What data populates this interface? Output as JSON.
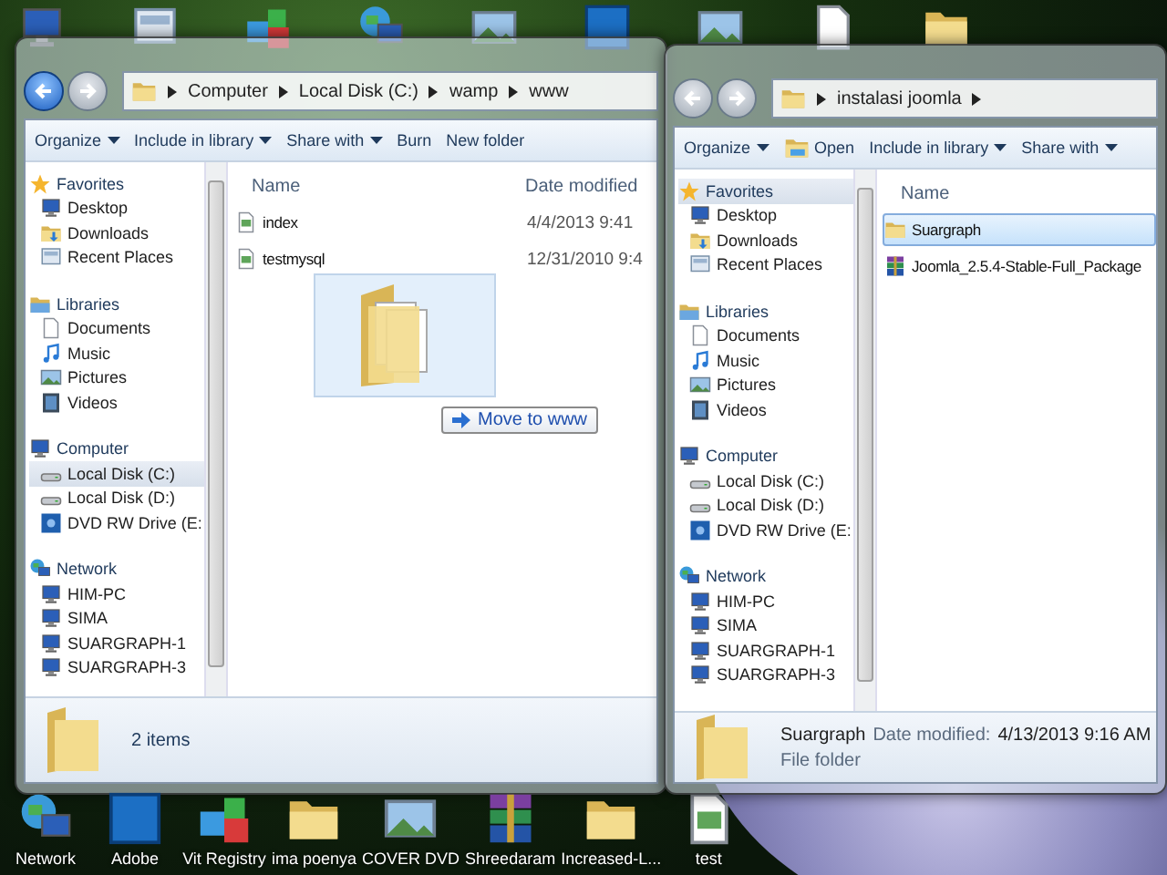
{
  "desktop_icons": [
    {
      "label": "Network",
      "kind": "network"
    },
    {
      "label": "Adobe",
      "kind": "app"
    },
    {
      "label": "Vit Registry",
      "kind": "tools"
    },
    {
      "label": "ima poenya",
      "kind": "folder"
    },
    {
      "label": "COVER DVD",
      "kind": "image"
    },
    {
      "label": "Shreedaram",
      "kind": "archive"
    },
    {
      "label": "Increased-L...",
      "kind": "folder"
    },
    {
      "label": "test",
      "kind": "file"
    }
  ],
  "windows": [
    {
      "back_enabled": true,
      "address": [
        "Computer",
        "Local Disk (C:)",
        "wamp",
        "www"
      ],
      "trailing_arrow": false,
      "toolbar": [
        {
          "label": "Organize",
          "kind": "dropdown"
        },
        {
          "label": "Include in library",
          "kind": "dropdown"
        },
        {
          "label": "Share with",
          "kind": "dropdown"
        },
        {
          "label": "Burn",
          "kind": "button"
        },
        {
          "label": "New folder",
          "kind": "button"
        }
      ],
      "nav": [
        {
          "label": "Favorites",
          "kind": "star",
          "selected": false,
          "children": [
            {
              "label": "Desktop",
              "kind": "monitor",
              "selected": false
            },
            {
              "label": "Downloads",
              "kind": "downloads",
              "selected": false
            },
            {
              "label": "Recent Places",
              "kind": "recent",
              "selected": false
            }
          ]
        },
        {
          "label": "Libraries",
          "kind": "library",
          "selected": false,
          "children": [
            {
              "label": "Documents",
              "kind": "document",
              "selected": false
            },
            {
              "label": "Music",
              "kind": "music",
              "selected": false
            },
            {
              "label": "Pictures",
              "kind": "picture",
              "selected": false
            },
            {
              "label": "Videos",
              "kind": "video",
              "selected": false
            }
          ]
        },
        {
          "label": "Computer",
          "kind": "computer",
          "selected": false,
          "children": [
            {
              "label": "Local Disk (C:)",
              "kind": "disk",
              "selected": true
            },
            {
              "label": "Local Disk (D:)",
              "kind": "disk",
              "selected": false
            },
            {
              "label": "DVD RW Drive (E:",
              "kind": "dvd",
              "selected": false
            }
          ]
        },
        {
          "label": "Network",
          "kind": "network",
          "selected": false,
          "children": [
            {
              "label": "HIM-PC",
              "kind": "computer",
              "selected": false
            },
            {
              "label": "SIMA",
              "kind": "computer",
              "selected": false
            },
            {
              "label": "SUARGRAPH-1",
              "kind": "computer",
              "selected": false
            },
            {
              "label": "SUARGRAPH-3",
              "kind": "computer",
              "selected": false
            }
          ]
        }
      ],
      "columns": [
        "Name",
        "Date modified"
      ],
      "files": [
        {
          "name": "index",
          "kind": "file",
          "date": "4/4/2013 9:41",
          "selected": false
        },
        {
          "name": "testmysql",
          "kind": "file",
          "date": "12/31/2010 9:4",
          "selected": false
        }
      ],
      "status": {
        "text": "2 items"
      }
    },
    {
      "back_enabled": false,
      "address": [
        "instalasi joomla"
      ],
      "trailing_arrow": true,
      "toolbar": [
        {
          "label": "Organize",
          "kind": "dropdown"
        },
        {
          "label": "Open",
          "kind": "icon-button"
        },
        {
          "label": "Include in library",
          "kind": "dropdown"
        },
        {
          "label": "Share with",
          "kind": "dropdown"
        }
      ],
      "nav": [
        {
          "label": "Favorites",
          "kind": "star",
          "selected": true,
          "children": [
            {
              "label": "Desktop",
              "kind": "monitor",
              "selected": false
            },
            {
              "label": "Downloads",
              "kind": "downloads",
              "selected": false
            },
            {
              "label": "Recent Places",
              "kind": "recent",
              "selected": false
            }
          ]
        },
        {
          "label": "Libraries",
          "kind": "library",
          "selected": false,
          "children": [
            {
              "label": "Documents",
              "kind": "document",
              "selected": false
            },
            {
              "label": "Music",
              "kind": "music",
              "selected": false
            },
            {
              "label": "Pictures",
              "kind": "picture",
              "selected": false
            },
            {
              "label": "Videos",
              "kind": "video",
              "selected": false
            }
          ]
        },
        {
          "label": "Computer",
          "kind": "computer",
          "selected": false,
          "children": [
            {
              "label": "Local Disk (C:)",
              "kind": "disk",
              "selected": false
            },
            {
              "label": "Local Disk (D:)",
              "kind": "disk",
              "selected": false
            },
            {
              "label": "DVD RW Drive (E:",
              "kind": "dvd",
              "selected": false
            }
          ]
        },
        {
          "label": "Network",
          "kind": "network",
          "selected": false,
          "children": [
            {
              "label": "HIM-PC",
              "kind": "computer",
              "selected": false
            },
            {
              "label": "SIMA",
              "kind": "computer",
              "selected": false
            },
            {
              "label": "SUARGRAPH-1",
              "kind": "computer",
              "selected": false
            },
            {
              "label": "SUARGRAPH-3",
              "kind": "computer",
              "selected": false
            }
          ]
        }
      ],
      "columns": [
        "Name"
      ],
      "files": [
        {
          "name": "Suargraph",
          "kind": "folder",
          "selected": true
        },
        {
          "name": "Joomla_2.5.4-Stable-Full_Package",
          "kind": "archive",
          "selected": false
        }
      ],
      "status": {
        "name": "Suargraph",
        "date_label": "Date modified:",
        "date": "4/13/2013 9:16 AM",
        "type": "File folder"
      }
    }
  ],
  "drag": {
    "tooltip": "Move to www"
  }
}
